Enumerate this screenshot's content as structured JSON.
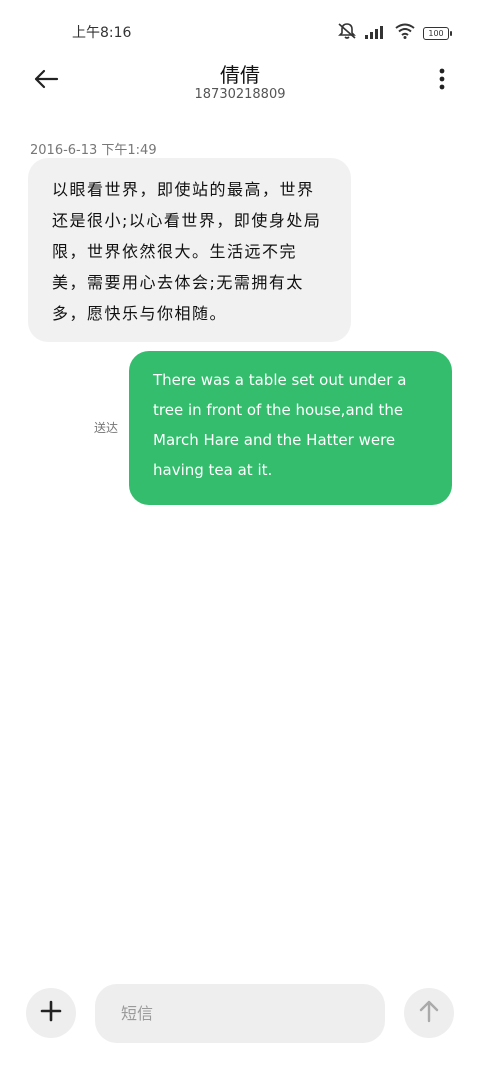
{
  "status_bar": {
    "time": "上午8:16",
    "battery_level": "100",
    "icons": [
      "mute-icon",
      "signal-icon",
      "wifi-icon",
      "battery-icon"
    ]
  },
  "header": {
    "contact_name": "倩倩",
    "phone_number": "18730218809",
    "back_icon": "back-arrow-icon",
    "more_icon": "more-vertical-icon"
  },
  "conversation": {
    "timestamp": "2016-6-13 下午1:49",
    "messages": [
      {
        "direction": "incoming",
        "text": "以眼看世界，即使站的最高，世界还是很小;以心看世界，即使身处局限，世界依然很大。生活远不完美，需要用心去体会;无需拥有太多，愿快乐与你相随。"
      },
      {
        "direction": "outgoing",
        "text": "There was a table set out under a tree in front of the house,and the March Hare and the Hatter were having tea at it.",
        "status": "送达"
      }
    ]
  },
  "composer": {
    "placeholder": "短信",
    "value": "",
    "add_icon": "plus-icon",
    "send_icon": "send-arrow-icon"
  },
  "colors": {
    "outgoing_bubble": "#33bd6d",
    "incoming_bubble": "#f1f1f1",
    "background": "#ffffff"
  }
}
